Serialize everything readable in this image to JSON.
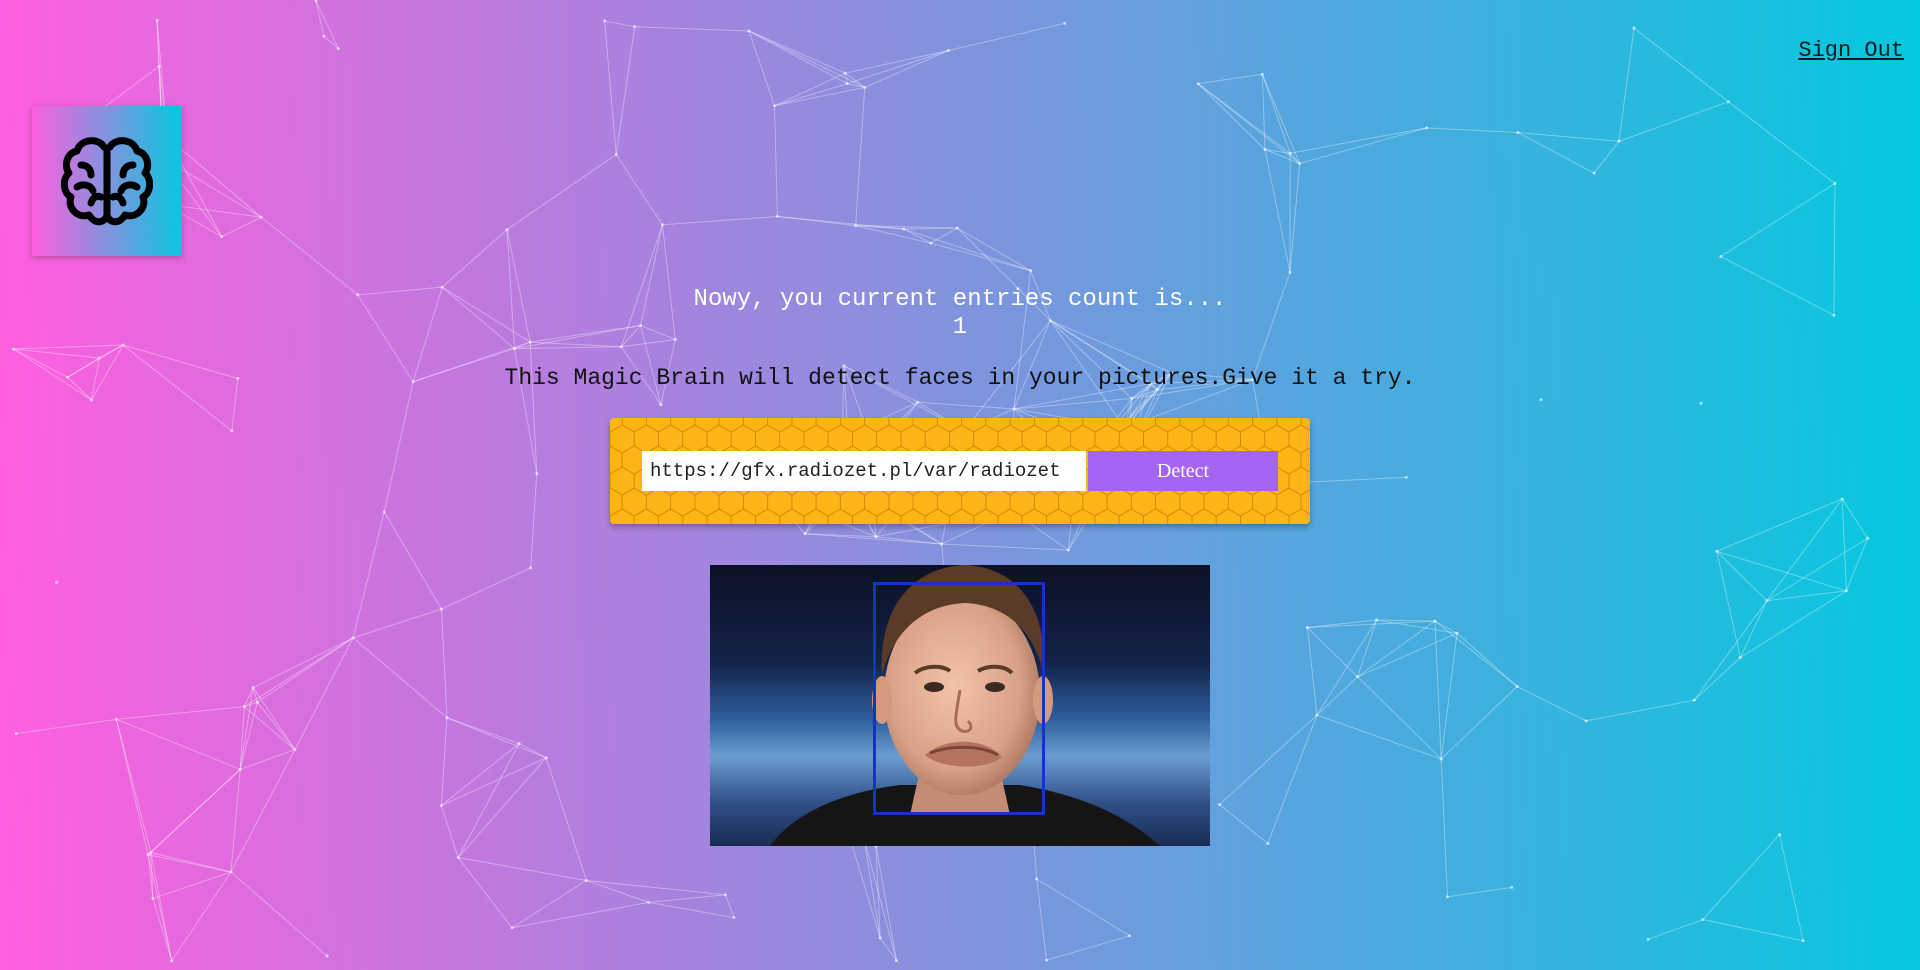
{
  "header": {
    "sign_out_label": "Sign Out"
  },
  "logo": {
    "icon": "brain-icon"
  },
  "rank": {
    "message": "Nowy, you current entries count is...",
    "count": "1"
  },
  "tagline": "This Magic Brain will detect faces in your pictures.Give it a try.",
  "form": {
    "url_value": "https://gfx.radiozet.pl/var/radiozet",
    "detect_label": "Detect"
  },
  "colors": {
    "gradient_start": "#ff5edf",
    "gradient_end": "#04c8de",
    "panel": "#fdb515",
    "button": "#a463f2",
    "face_box": "#1633c5"
  }
}
